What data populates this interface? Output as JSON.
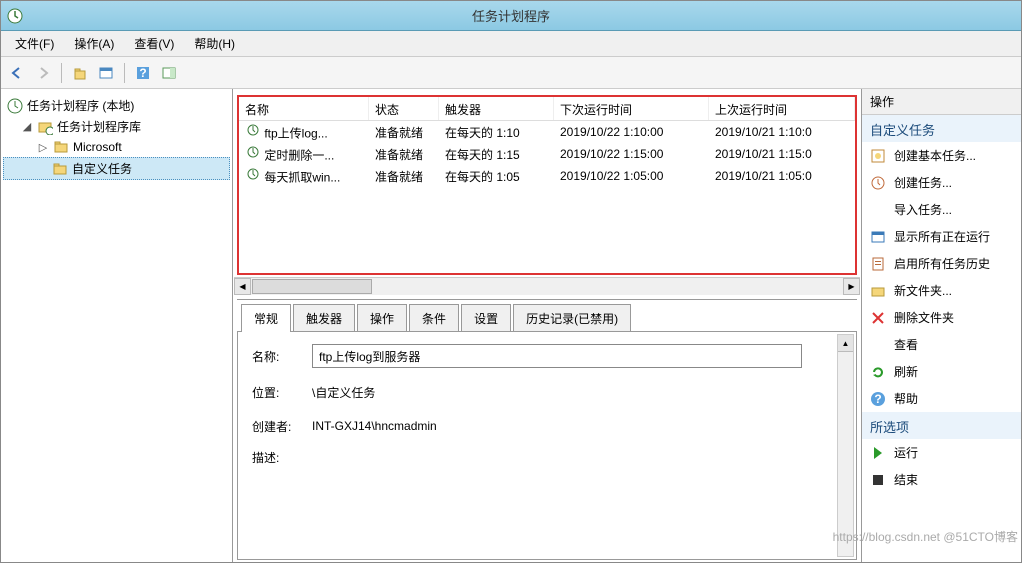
{
  "window": {
    "title": "任务计划程序"
  },
  "menu": {
    "file": "文件(F)",
    "action": "操作(A)",
    "view": "查看(V)",
    "help": "帮助(H)"
  },
  "tree": {
    "root": "任务计划程序 (本地)",
    "lib": "任务计划程序库",
    "microsoft": "Microsoft",
    "custom": "自定义任务"
  },
  "list": {
    "headers": {
      "name": "名称",
      "status": "状态",
      "trigger": "触发器",
      "next": "下次运行时间",
      "last": "上次运行时间"
    },
    "rows": [
      {
        "name": "ftp上传log...",
        "status": "准备就绪",
        "trigger": "在每天的 1:10",
        "next": "2019/10/22 1:10:00",
        "last": "2019/10/21 1:10:0"
      },
      {
        "name": "定时删除一...",
        "status": "准备就绪",
        "trigger": "在每天的 1:15",
        "next": "2019/10/22 1:15:00",
        "last": "2019/10/21 1:15:0"
      },
      {
        "name": "每天抓取win...",
        "status": "准备就绪",
        "trigger": "在每天的 1:05",
        "next": "2019/10/22 1:05:00",
        "last": "2019/10/21 1:05:0"
      }
    ]
  },
  "tabs": {
    "general": "常规",
    "triggers": "触发器",
    "actions": "操作",
    "conditions": "条件",
    "settings": "设置",
    "history": "历史记录(已禁用)"
  },
  "form": {
    "name_label": "名称:",
    "name_value": "ftp上传log到服务器",
    "loc_label": "位置:",
    "loc_value": "\\自定义任务",
    "creator_label": "创建者:",
    "creator_value": "INT-GXJ14\\hncmadmin",
    "desc_label": "描述:"
  },
  "actions": {
    "header": "操作",
    "section1": "自定义任务",
    "items1": [
      "创建基本任务...",
      "创建任务...",
      "导入任务...",
      "显示所有正在运行",
      "启用所有任务历史",
      "新文件夹...",
      "删除文件夹",
      "查看",
      "刷新",
      "帮助"
    ],
    "section2": "所选项",
    "items2": [
      "运行",
      "结束"
    ]
  },
  "watermark": "https://blog.csdn.net @51CTO博客"
}
